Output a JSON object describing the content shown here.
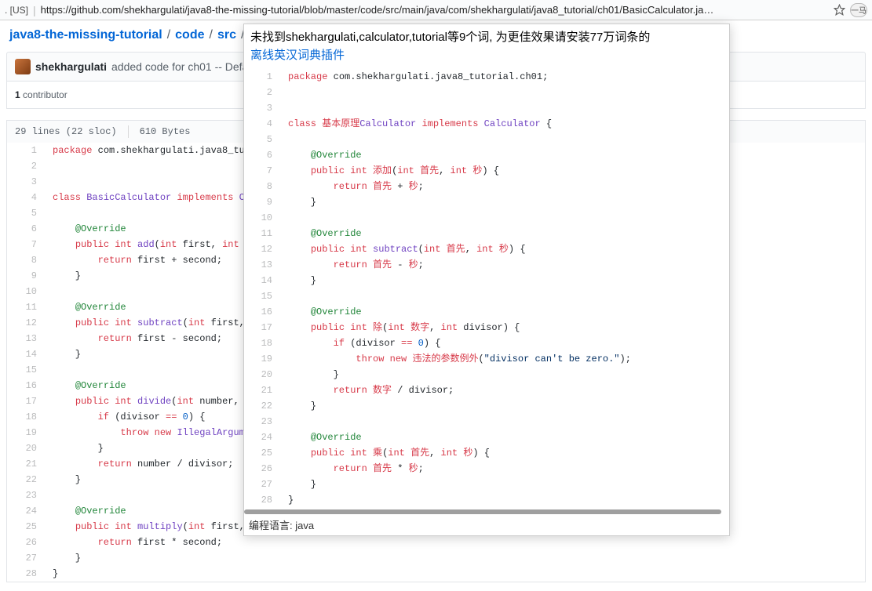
{
  "browser": {
    "lead": ". [US]",
    "url": "https://github.com/shekhargulati/java8-the-missing-tutorial/blob/master/code/src/main/java/com/shekhargulati/java8_tutorial/ch01/BasicCalculator.ja…",
    "profile_label": "一马"
  },
  "breadcrumb": {
    "items": [
      "java8-the-missing-tutorial",
      "code",
      "src"
    ],
    "sep": "/"
  },
  "commit": {
    "author": "shekhargulati",
    "message": "added code for ch01 -- Defaul"
  },
  "contributors": {
    "count": "1",
    "label": "contributor"
  },
  "filebar": {
    "lines": "29 lines (22 sloc)",
    "bytes": "610 Bytes"
  },
  "main_code": [
    {
      "n": 1,
      "html": "<span class='kw'>package</span> com.shekhargulati.java8_tutor"
    },
    {
      "n": 2,
      "html": ""
    },
    {
      "n": 3,
      "html": ""
    },
    {
      "n": 4,
      "html": "<span class='kw'>class</span> <span class='type'>BasicCalculator</span> <span class='kw'>implements</span> <span class='type'>Calc</span>"
    },
    {
      "n": 5,
      "html": ""
    },
    {
      "n": 6,
      "html": "    <span class='ann'>@Override</span>"
    },
    {
      "n": 7,
      "html": "    <span class='kw'>public</span> <span class='kw'>int</span> <span class='fn'>add</span>(<span class='kw'>int</span> first, <span class='kw'>int</span> sec"
    },
    {
      "n": 8,
      "html": "        <span class='kw'>return</span> first + second;"
    },
    {
      "n": 9,
      "html": "    }"
    },
    {
      "n": 10,
      "html": ""
    },
    {
      "n": 11,
      "html": "    <span class='ann'>@Override</span>"
    },
    {
      "n": 12,
      "html": "    <span class='kw'>public</span> <span class='kw'>int</span> <span class='fn'>subtract</span>(<span class='kw'>int</span> first, <span class='kw'>ir</span>"
    },
    {
      "n": 13,
      "html": "        <span class='kw'>return</span> first - second;"
    },
    {
      "n": 14,
      "html": "    }"
    },
    {
      "n": 15,
      "html": ""
    },
    {
      "n": 16,
      "html": "    <span class='ann'>@Override</span>"
    },
    {
      "n": 17,
      "html": "    <span class='kw'>public</span> <span class='kw'>int</span> <span class='fn'>divide</span>(<span class='kw'>int</span> number, <span class='kw'>int</span>"
    },
    {
      "n": 18,
      "html": "        <span class='kw'>if</span> (divisor <span class='kw'>==</span> <span class='num-lit'>0</span>) {"
    },
    {
      "n": 19,
      "html": "            <span class='kw'>throw</span> <span class='kw'>new</span> <span class='type'>IllegalArgument</span>"
    },
    {
      "n": 20,
      "html": "        }"
    },
    {
      "n": 21,
      "html": "        <span class='kw'>return</span> number / divisor;"
    },
    {
      "n": 22,
      "html": "    }"
    },
    {
      "n": 23,
      "html": ""
    },
    {
      "n": 24,
      "html": "    <span class='ann'>@Override</span>"
    },
    {
      "n": 25,
      "html": "    <span class='kw'>public</span> <span class='kw'>int</span> <span class='fn'>multiply</span>(<span class='kw'>int</span> first, <span class='kw'>int</span> second) {"
    },
    {
      "n": 26,
      "html": "        <span class='kw'>return</span> first * second;"
    },
    {
      "n": 27,
      "html": "    }"
    },
    {
      "n": 28,
      "html": "}"
    }
  ],
  "overlay": {
    "header_prefix": "未找到shekhargulati,calculator,tutorial等9个词, 为更佳效果请安装77万词条的",
    "header_link": "离线英汉词典插件",
    "footer": "编程语言: java",
    "code": [
      {
        "n": 1,
        "html": "<span class='kw'>package</span> com.shekhargulati.java8_tutorial.ch01;"
      },
      {
        "n": 2,
        "html": ""
      },
      {
        "n": 3,
        "html": ""
      },
      {
        "n": 4,
        "html": "<span class='kw'>class</span> <span class='zh'>基本原理</span><span class='type'>Calculator</span> <span class='kw'>implements</span> <span class='type'>Calculator</span> {"
      },
      {
        "n": 5,
        "html": ""
      },
      {
        "n": 6,
        "html": "    <span class='ann'>@Override</span>"
      },
      {
        "n": 7,
        "html": "    <span class='kw'>public</span> <span class='kw'>int</span> <span class='zh'>添加</span>(<span class='kw'>int</span> <span class='zh'>首先</span>, <span class='kw'>int</span> <span class='zh'>秒</span>) {"
      },
      {
        "n": 8,
        "html": "        <span class='kw'>return</span> <span class='zh'>首先</span> + <span class='zh'>秒</span>;"
      },
      {
        "n": 9,
        "html": "    }"
      },
      {
        "n": 10,
        "html": ""
      },
      {
        "n": 11,
        "html": "    <span class='ann'>@Override</span>"
      },
      {
        "n": 12,
        "html": "    <span class='kw'>public</span> <span class='kw'>int</span> <span class='fn'>subtract</span>(<span class='kw'>int</span> <span class='zh'>首先</span>, <span class='kw'>int</span> <span class='zh'>秒</span>) {"
      },
      {
        "n": 13,
        "html": "        <span class='kw'>return</span> <span class='zh'>首先</span> - <span class='zh'>秒</span>;"
      },
      {
        "n": 14,
        "html": "    }"
      },
      {
        "n": 15,
        "html": ""
      },
      {
        "n": 16,
        "html": "    <span class='ann'>@Override</span>"
      },
      {
        "n": 17,
        "html": "    <span class='kw'>public</span> <span class='kw'>int</span> <span class='zh'>除</span>(<span class='kw'>int</span> <span class='zh'>数字</span>, <span class='kw'>int</span> divisor) {"
      },
      {
        "n": 18,
        "html": "        <span class='kw'>if</span> (divisor <span class='kw'>==</span> <span class='num-lit'>0</span>) {"
      },
      {
        "n": 19,
        "html": "            <span class='kw'>throw</span> <span class='kw'>new</span> <span class='zh'>违法的参数例外</span>(<span class='str'>\"divisor can't be zero.\"</span>);"
      },
      {
        "n": 20,
        "html": "        }"
      },
      {
        "n": 21,
        "html": "        <span class='kw'>return</span> <span class='zh'>数字</span> / divisor;"
      },
      {
        "n": 22,
        "html": "    }"
      },
      {
        "n": 23,
        "html": ""
      },
      {
        "n": 24,
        "html": "    <span class='ann'>@Override</span>"
      },
      {
        "n": 25,
        "html": "    <span class='kw'>public</span> <span class='kw'>int</span> <span class='zh'>乘</span>(<span class='kw'>int</span> <span class='zh'>首先</span>, <span class='kw'>int</span> <span class='zh'>秒</span>) {"
      },
      {
        "n": 26,
        "html": "        <span class='kw'>return</span> <span class='zh'>首先</span> * <span class='zh'>秒</span>;"
      },
      {
        "n": 27,
        "html": "    }"
      },
      {
        "n": 28,
        "html": "}"
      }
    ]
  }
}
